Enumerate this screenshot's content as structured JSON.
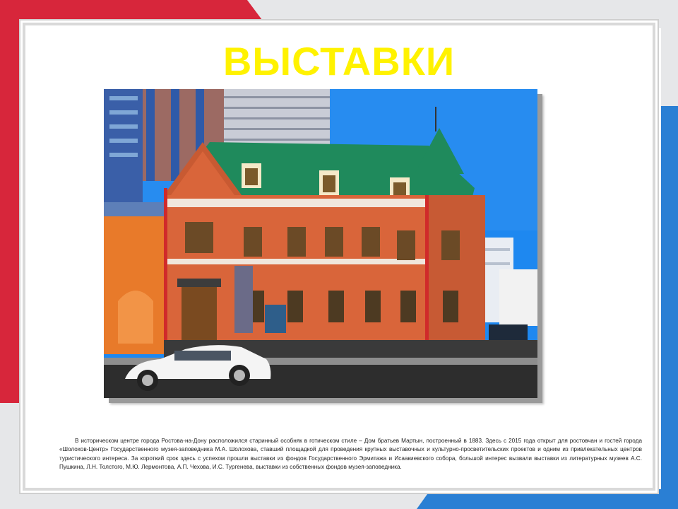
{
  "slide": {
    "title": "ВЫСТАВКИ",
    "caption": "В историческом центре города Ростова-на-Дону расположился старинный особняк в готическом стиле – Дом братьев Мартын, построенный в 1883. Здесь с 2015 года открыт для ростовчан и гостей города «Шолохов-Центр» Государственного музея-заповедника М.А. Шолохова, ставший площадкой для проведения крупных выставочных и культурно-просветительских проектов и одним из привлекательных центров туристического интереса. За короткий срок здесь с успехом прошли выставки из фондов Государственного Эрмитажа и Исаакиевского собора, большой интерес вызвали выставки из литературных музеев А.С. Пушкина, Л.Н. Толстого, М.Ю. Лермонтова, А.П. Чехова, И.С. Тургенева, выставки из собственных фондов музея-заповедника."
  },
  "colors": {
    "title": "#fff200",
    "accent_red": "#d7263b",
    "accent_blue": "#2a7fd4",
    "frame_gray": "#d9d9d9",
    "sky": "#1e88f0",
    "brick": "#d9653a",
    "roof": "#1f8a5c"
  }
}
